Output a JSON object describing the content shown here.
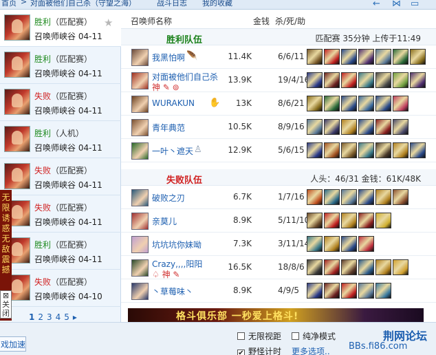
{
  "topnav": {
    "home": "首页",
    "sep": ">",
    "crumb": "对面被他们自己杀（守望之海）",
    "battle_log": "战斗日志",
    "favorites": "我的收藏"
  },
  "left_list": {
    "matches": [
      {
        "result": "胜利",
        "mode": "（匹配赛）",
        "location": "召唤师峡谷",
        "date": "04-11",
        "outcome": "win",
        "selected": true
      },
      {
        "result": "胜利",
        "mode": "（匹配赛）",
        "location": "召唤师峡谷",
        "date": "04-11",
        "outcome": "win"
      },
      {
        "result": "失败",
        "mode": "（匹配赛）",
        "location": "召唤师峡谷",
        "date": "04-11",
        "outcome": "lose"
      },
      {
        "result": "胜利",
        "mode": "（人机）",
        "location": "召唤师峡谷",
        "date": "04-11",
        "outcome": "win"
      },
      {
        "result": "失败",
        "mode": "（匹配赛）",
        "location": "召唤师峡谷",
        "date": "04-11",
        "outcome": "lose"
      },
      {
        "result": "失败",
        "mode": "（匹配赛）",
        "location": "召唤师峡谷",
        "date": "04-11",
        "outcome": "lose"
      },
      {
        "result": "胜利",
        "mode": "（匹配赛）",
        "location": "召唤师峡谷",
        "date": "04-11",
        "outcome": "win"
      },
      {
        "result": "失败",
        "mode": "（匹配赛）",
        "location": "召唤师峡谷",
        "date": "04-10",
        "outcome": "lose"
      }
    ],
    "pager": {
      "pages": [
        "1",
        "2",
        "3",
        "4",
        "5"
      ],
      "next": "▸"
    }
  },
  "side_ad": {
    "text": "无限诱惑 无敌震撼",
    "close": "关闭"
  },
  "main": {
    "col_name": "召唤师名称",
    "col_gold": "金钱",
    "col_kda": "杀/死/助",
    "win_team": {
      "label": "胜利队伍",
      "info": "匹配赛 35分钟 上传于11:49",
      "players": [
        {
          "name": "我黑怕啊",
          "gold": "11.4K",
          "kda": "6/6/11",
          "pic": "#6a4a3a",
          "emo": "🪶",
          "items": [
            "#7a5a2a",
            "#c02020",
            "#2a4a8a",
            "#503070",
            "#5a7a9a",
            "#2a6a3a",
            "#8a7020"
          ]
        },
        {
          "name": "对面被他们自己杀",
          "gold": "13.9K",
          "kda": "19/4/16",
          "pic": "#a03020",
          "marks": "神 ✎ ⊚",
          "items": [
            "#2a3a8a",
            "#6a2020",
            "#c02020",
            "#3a7a8a",
            "#4a4a4a",
            "#70a040",
            "#503070"
          ]
        },
        {
          "name": "WURAKUN",
          "gold": "13K",
          "kda": "8/6/21",
          "pic": "#6a4020",
          "emo": "✋",
          "items": [
            "#8a7020",
            "#2a6a3a",
            "#2a4a8a",
            "#3a6aa0",
            "#2a4a8a",
            "#c04060"
          ]
        },
        {
          "name": "青年典范",
          "gold": "10.5K",
          "kda": "8/9/16",
          "pic": "#7a5030",
          "items": [
            "#5a7a9a",
            "#3a3a6a",
            "#b08020",
            "#2a4a8a",
            "#8a2020",
            "#4a4a6a"
          ]
        },
        {
          "name": "一叶丶遮天",
          "gold": "12.9K",
          "kda": "5/6/15",
          "pic": "#2a6a2a",
          "emo": "♙",
          "items": [
            "#2a3a8a",
            "#a05020",
            "#7a5a2a",
            "#3a7a8a",
            "#4a3a2a",
            "#b08020",
            "#2a4a8a"
          ]
        }
      ]
    },
    "lose_team": {
      "label": "失败队伍",
      "info": "人头：46/31 金钱：61K/48K",
      "players": [
        {
          "name": "破败之刃",
          "gold": "6.7K",
          "kda": "1/7/16",
          "pic": "#2a5a7a",
          "items": [
            "#c05020",
            "#2a6a8a",
            "#5a7a9a",
            "#2a4a8a",
            "#b08020",
            "#8a5030"
          ]
        },
        {
          "name": "亲莫儿",
          "gold": "8.9K",
          "kda": "5/11/10",
          "pic": "#a03030",
          "items": [
            "#6a4a2a",
            "#c02020",
            "#b08020",
            "#8a2020",
            "#d0b030"
          ]
        },
        {
          "name": "坑坑坑你妹呦",
          "gold": "7.3K",
          "kda": "3/11/14",
          "pic": "#c0a0d0",
          "items": [
            "#3a7a8a",
            "#b08020",
            "#2a4a8a",
            "#c03040"
          ]
        },
        {
          "name": "Crazy,,,,阳阳",
          "gold": "16.5K",
          "kda": "18/8/6",
          "pic": "#2a4a2a",
          "marks": "♤ 神 ✎",
          "items": [
            "#3a3a3a",
            "#a02020",
            "#5a3a2a",
            "#2a5a8a",
            "#b08020",
            "#d0a030"
          ]
        },
        {
          "name": "丶草莓味丶",
          "gold": "8.9K",
          "kda": "4/9/5",
          "pic": "#2a3a6a",
          "items": [
            "#2a3a8a",
            "#6a2020",
            "#c02020",
            "#5a7a9a",
            "#3a7aa0"
          ]
        }
      ]
    },
    "banner": "格斗俱乐部 一秒爱上格斗!"
  },
  "bottom": {
    "accel": "戏加速",
    "opt_unlimited_view": "无限视距",
    "opt_pure_mode": "纯净模式",
    "opt_timer": "野怪计时",
    "timer_checked": "✔",
    "more": "更多选项..",
    "watermark_cn": "荆网论坛",
    "watermark_url": "BBs.fi86.com"
  }
}
